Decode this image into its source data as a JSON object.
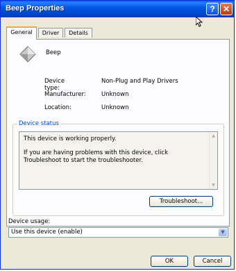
{
  "window": {
    "title": "Beep Properties",
    "help_glyph": "?",
    "close_glyph": "✕"
  },
  "tabs": [
    {
      "label": "General",
      "active": true
    },
    {
      "label": "Driver",
      "active": false
    },
    {
      "label": "Details",
      "active": false
    }
  ],
  "device": {
    "name": "Beep",
    "icon": "device-diamond-icon",
    "rows": [
      {
        "label": "Device type:",
        "value": "Non-Plug and Play Drivers"
      },
      {
        "label": "Manufacturer:",
        "value": "Unknown"
      },
      {
        "label": "Location:",
        "value": "Unknown"
      }
    ]
  },
  "status": {
    "group_title": "Device status",
    "line1": "This device is working properly.",
    "line2": "If you are having problems with this device, click Troubleshoot to start the troubleshooter.",
    "troubleshoot_label": "Troubleshoot..."
  },
  "usage": {
    "label": "Device usage:",
    "selected": "Use this device (enable)"
  },
  "buttons": {
    "ok": "OK",
    "cancel": "Cancel"
  },
  "colors": {
    "title_bar": "#0058e6",
    "accent_tab": "#f3a73c",
    "group_title": "#0046d5"
  }
}
